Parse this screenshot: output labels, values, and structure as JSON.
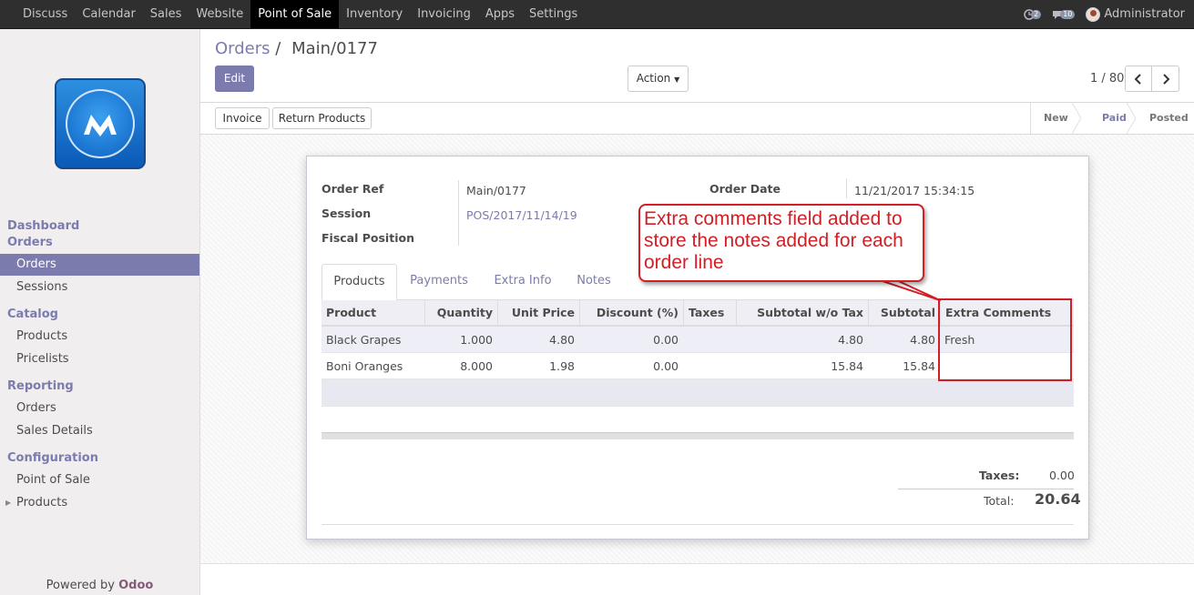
{
  "topbar": {
    "menu": [
      "Discuss",
      "Calendar",
      "Sales",
      "Website",
      "Point of Sale",
      "Inventory",
      "Invoicing",
      "Apps",
      "Settings"
    ],
    "active_menu": "Point of Sale",
    "activity_count": "2",
    "message_count": "10",
    "user": "Administrator"
  },
  "sidebar": {
    "sections": [
      {
        "heading": "Dashboard",
        "items": []
      },
      {
        "heading": "Orders",
        "items": [
          "Orders",
          "Sessions"
        ]
      },
      {
        "heading": "Catalog",
        "items": [
          "Products",
          "Pricelists"
        ]
      },
      {
        "heading": "Reporting",
        "items": [
          "Orders",
          "Sales Details"
        ]
      },
      {
        "heading": "Configuration",
        "items": [
          "Point of Sale",
          "Products"
        ]
      }
    ],
    "active_item": "Orders",
    "powered_prefix": "Powered by",
    "powered_brand": "Odoo"
  },
  "control": {
    "breadcrumb_parent": "Orders",
    "breadcrumb_sep": "/",
    "breadcrumb_current": "Main/0177",
    "edit_label": "Edit",
    "action_label": "Action",
    "pager": "1 / 80"
  },
  "statusbar": {
    "buttons": [
      "Invoice",
      "Return Products"
    ],
    "stages": [
      "New",
      "Paid",
      "Posted"
    ],
    "current_stage": "Paid"
  },
  "form": {
    "order_ref_label": "Order Ref",
    "order_ref": "Main/0177",
    "session_label": "Session",
    "session": "POS/2017/11/14/19",
    "fiscal_label": "Fiscal Position",
    "fiscal_value": "",
    "order_date_label": "Order Date",
    "order_date": "11/21/2017 15:34:15"
  },
  "tabs": [
    "Products",
    "Payments",
    "Extra Info",
    "Notes"
  ],
  "active_tab": "Products",
  "lines": {
    "columns": [
      "Product",
      "Quantity",
      "Unit Price",
      "Discount (%)",
      "Taxes",
      "Subtotal w/o Tax",
      "Subtotal",
      "Extra Comments"
    ],
    "rows": [
      {
        "product": "Black Grapes",
        "quantity": "1.000",
        "unit_price": "4.80",
        "discount": "0.00",
        "taxes": "",
        "subtotal_wo_tax": "4.80",
        "subtotal": "4.80",
        "extra_comments": "Fresh"
      },
      {
        "product": "Boni Oranges",
        "quantity": "8.000",
        "unit_price": "1.98",
        "discount": "0.00",
        "taxes": "",
        "subtotal_wo_tax": "15.84",
        "subtotal": "15.84",
        "extra_comments": ""
      }
    ]
  },
  "totals": {
    "taxes_label": "Taxes:",
    "taxes": "0.00",
    "total_label": "Total:",
    "total": "20.64"
  },
  "annotation": {
    "text": "Extra comments field added to store the notes added for each order line",
    "color": "#d01f25"
  },
  "colors": {
    "accent": "#7c7bad",
    "navbar": "#2f2f2f",
    "brand": "#875a7b"
  }
}
